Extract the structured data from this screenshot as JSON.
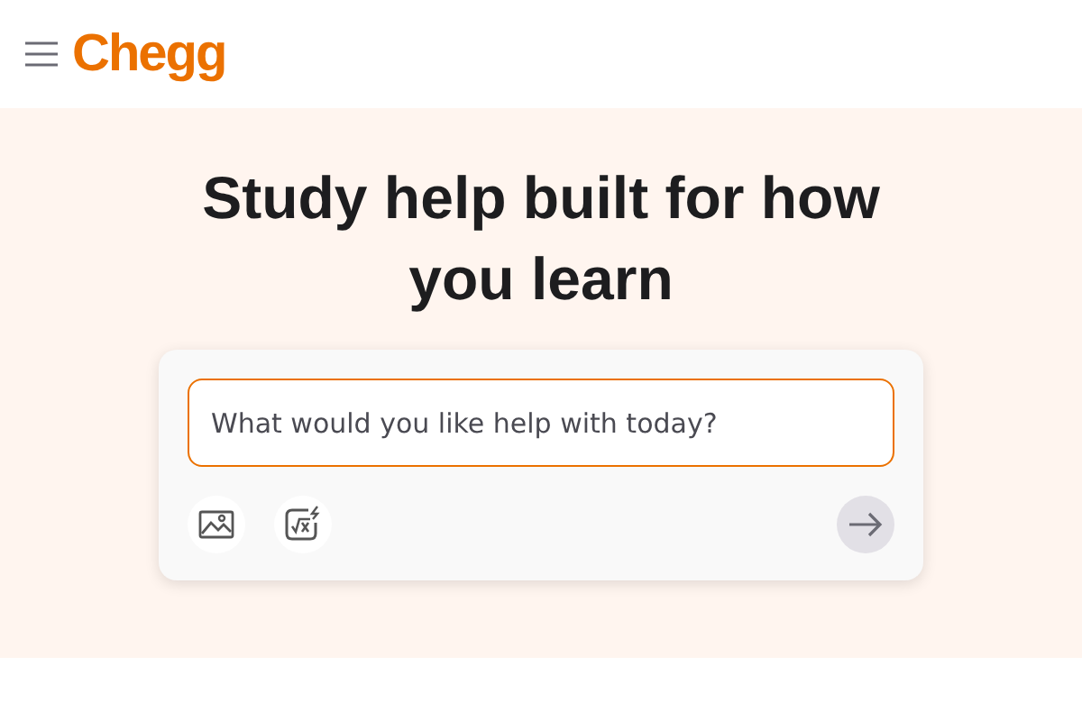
{
  "header": {
    "logo": "Chegg"
  },
  "hero": {
    "title": "Study help built for how you learn"
  },
  "search": {
    "placeholder": "What would you like help with today?",
    "focused": true
  },
  "submit": {
    "disabled": true
  }
}
